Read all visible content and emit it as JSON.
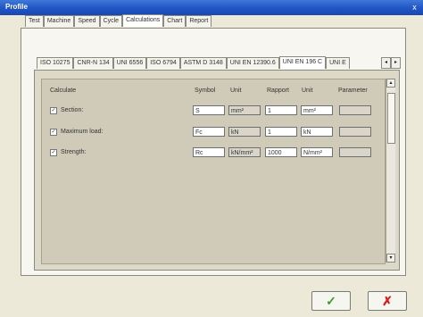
{
  "window": {
    "title": "Profile",
    "close": "x"
  },
  "tabs": [
    "Test",
    "Machine",
    "Speed",
    "Cycle",
    "Calculations",
    "Chart",
    "Report"
  ],
  "subtabs": [
    "ISO 10275",
    "CNR-N 134",
    "UNI 6556",
    "ISO 6794",
    "ASTM D 3148",
    "UNI EN 12390.6",
    "UNI EN 196 C",
    "UNI E"
  ],
  "headers": {
    "calculate": "Calculate",
    "symbol": "Symbol",
    "unit": "Unit",
    "rapport": "Rapport",
    "unit2": "Unit",
    "parameter": "Parameter"
  },
  "rows": [
    {
      "checked": true,
      "label": "Section:",
      "symbol": "S",
      "unit": "mm²",
      "rapport": "1",
      "unit2": "mm²",
      "parameter": ""
    },
    {
      "checked": true,
      "label": "Maximum load:",
      "symbol": "Fc",
      "unit": "kN",
      "rapport": "1",
      "unit2": "kN",
      "parameter": ""
    },
    {
      "checked": true,
      "label": "Strength:",
      "symbol": "Rc",
      "unit": "kN/mm²",
      "rapport": "1000",
      "unit2": "N/mm²",
      "parameter": ""
    }
  ],
  "checkmark": "✓",
  "buttons": {
    "ok": "✓",
    "cancel": "✗"
  },
  "icons": {
    "scroll_left": "◂",
    "scroll_right": "▸",
    "scroll_up": "▴",
    "scroll_down": "▾"
  },
  "colors": {
    "ok": "#3e9a2b",
    "cancel": "#d02020",
    "title_bar": "#1f55c4"
  }
}
